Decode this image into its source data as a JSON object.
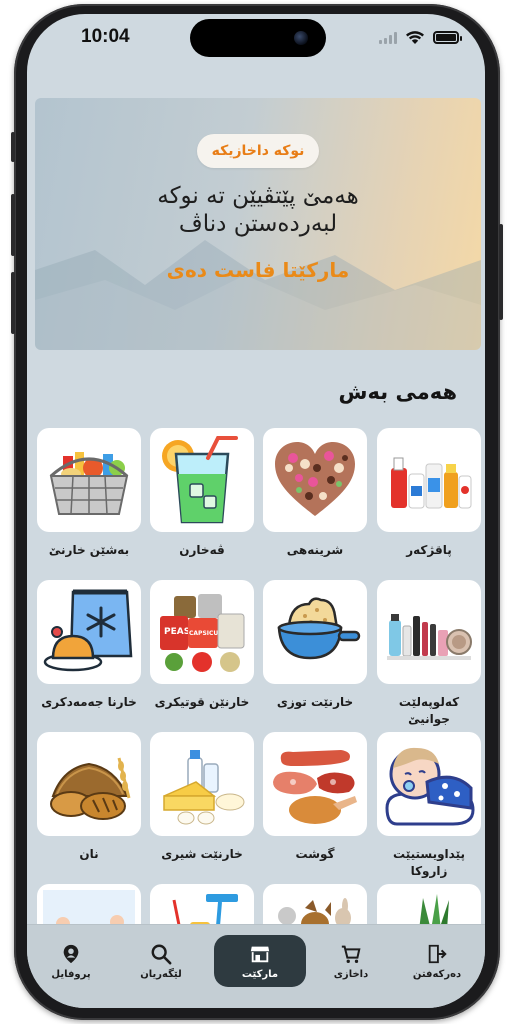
{
  "status_bar": {
    "time": "10:04"
  },
  "banner": {
    "badge": "نوکە داخازیکە",
    "headline_line1": "هەمێ پێتڤیێن تە نوکە",
    "headline_line2": "لبەردەستن دناڤ",
    "subline": "مارکێتا فاست دەی"
  },
  "section": {
    "title": "هەمی بەش"
  },
  "categories": [
    {
      "label": "پاقژکەر",
      "icon": "cleaning-products-icon"
    },
    {
      "label": "شرینەهی",
      "icon": "sweets-heart-icon"
    },
    {
      "label": "ڤەخارن",
      "icon": "drink-glass-icon"
    },
    {
      "label": "بەشێن خارنێ",
      "icon": "grocery-basket-icon"
    },
    {
      "label": "کەلوپەلێت جوانیێ",
      "icon": "cosmetics-icon"
    },
    {
      "label": "خارنێت توزی",
      "icon": "powder-bowl-icon"
    },
    {
      "label": "خارنێن قوتیکری",
      "icon": "canned-food-icon"
    },
    {
      "label": "خارنا جەمەدکری",
      "icon": "frozen-food-icon"
    },
    {
      "label": "پێداویستیێت زاروکا",
      "icon": "baby-icon"
    },
    {
      "label": "گوشت",
      "icon": "meat-icon"
    },
    {
      "label": "خارنێت شیری",
      "icon": "dairy-icon"
    },
    {
      "label": "نان",
      "icon": "bread-icon"
    },
    {
      "label": "",
      "icon": "vegetables-icon"
    },
    {
      "label": "",
      "icon": "pets-icon"
    },
    {
      "label": "",
      "icon": "cleaning-tools-icon"
    },
    {
      "label": "",
      "icon": "office-icon"
    }
  ],
  "bottom_nav": {
    "items": [
      {
        "label": "دەرکەفتن",
        "icon": "logout-icon"
      },
      {
        "label": "داخازی",
        "icon": "cart-icon"
      },
      {
        "label": "مارکێت",
        "icon": "store-icon"
      },
      {
        "label": "لێگەریان",
        "icon": "search-icon"
      },
      {
        "label": "پروفایل",
        "icon": "profile-icon"
      }
    ],
    "active": "مارکێت"
  },
  "colors": {
    "accent": "#ea8a18",
    "nav_active": "#2e3a40",
    "background": "#cfd9e0"
  }
}
